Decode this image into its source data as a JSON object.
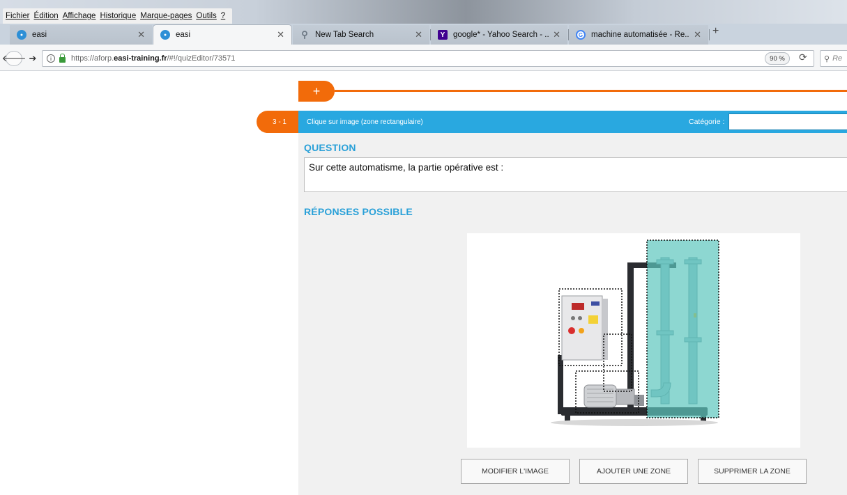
{
  "browser": {
    "menu": [
      "Fichier",
      "Édition",
      "Affichage",
      "Historique",
      "Marque-pages",
      "Outils",
      "?"
    ],
    "tabs": [
      {
        "title": "easi",
        "icon": "easi-favicon-icon",
        "active": false
      },
      {
        "title": "easi",
        "icon": "easi-favicon-icon",
        "active": true
      },
      {
        "title": "New Tab Search",
        "icon": "search-icon",
        "active": false
      },
      {
        "title": "google* - Yahoo Search - ...",
        "icon": "yahoo-favicon-icon",
        "active": false
      },
      {
        "title": "machine automatisée - Re...",
        "icon": "google-favicon-icon",
        "active": false
      }
    ],
    "new_tab_label": "+",
    "url_prefix": "https://aforp.",
    "url_host": "easi-training.fr",
    "url_path": "/#!/quizEditor/73571",
    "zoom": "90 %",
    "search_placeholder": "Re"
  },
  "editor": {
    "add_label": "+",
    "question_number": "3 - 1",
    "question_type": "Clique sur image (zone rectangulaire)",
    "category_label": "Catégorie :",
    "category_value": "",
    "question_section_title": "QUESTION",
    "question_text": "Sur cette automatisme, la partie opérative est :",
    "answers_section_title": "RÉPONSES POSSIBLE",
    "buttons": {
      "modify_image": "MODIFIER L'IMAGE",
      "add_zone": "AJOUTER UNE ZONE",
      "delete_zone": "SUPPRIMER LA ZONE"
    },
    "colors": {
      "accent_orange": "#f26b0a",
      "header_blue": "#29a8e0",
      "selected_zone": "#5cc6bd"
    }
  }
}
